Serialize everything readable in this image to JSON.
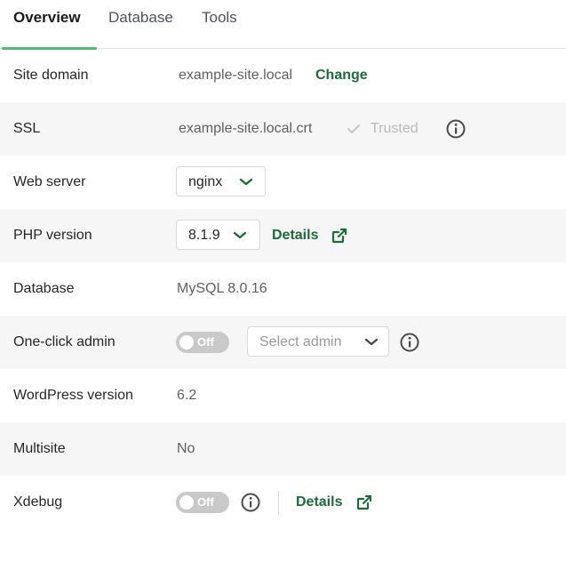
{
  "tabs": [
    {
      "label": "Overview"
    },
    {
      "label": "Database"
    },
    {
      "label": "Tools"
    }
  ],
  "rows": {
    "site_domain": {
      "label": "Site domain",
      "value": "example-site.local",
      "action": "Change"
    },
    "ssl": {
      "label": "SSL",
      "value": "example-site.local.crt",
      "status": "Trusted"
    },
    "web_server": {
      "label": "Web server",
      "selected": "nginx"
    },
    "php_version": {
      "label": "PHP version",
      "selected": "8.1.9",
      "link": "Details"
    },
    "database": {
      "label": "Database",
      "value": "MySQL 8.0.16"
    },
    "one_click_admin": {
      "label": "One-click admin",
      "toggle": "Off",
      "placeholder": "Select admin"
    },
    "wordpress_version": {
      "label": "WordPress version",
      "value": "6.2"
    },
    "multisite": {
      "label": "Multisite",
      "value": "No"
    },
    "xdebug": {
      "label": "Xdebug",
      "toggle": "Off",
      "link": "Details"
    }
  },
  "colors": {
    "accent": "#51bb7b",
    "link": "#1e6b3a",
    "muted": "#b9b9b9"
  }
}
